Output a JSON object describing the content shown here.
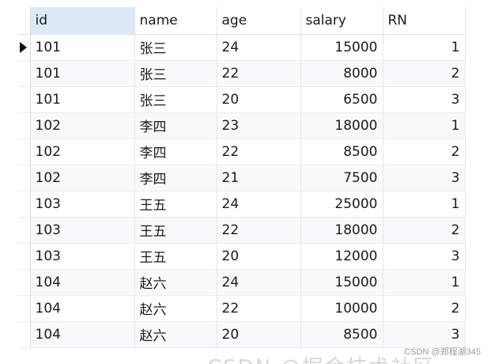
{
  "columns": [
    "id",
    "name",
    "age",
    "salary",
    "RN"
  ],
  "rows": [
    {
      "id": "101",
      "name": "张三",
      "age": "24",
      "salary": "15000",
      "rn": "1"
    },
    {
      "id": "101",
      "name": "张三",
      "age": "22",
      "salary": "8000",
      "rn": "2"
    },
    {
      "id": "101",
      "name": "张三",
      "age": "20",
      "salary": "6500",
      "rn": "3"
    },
    {
      "id": "102",
      "name": "李四",
      "age": "23",
      "salary": "18000",
      "rn": "1"
    },
    {
      "id": "102",
      "name": "李四",
      "age": "22",
      "salary": "8500",
      "rn": "2"
    },
    {
      "id": "102",
      "name": "李四",
      "age": "21",
      "salary": "7500",
      "rn": "3"
    },
    {
      "id": "103",
      "name": "王五",
      "age": "24",
      "salary": "25000",
      "rn": "1"
    },
    {
      "id": "103",
      "name": "王五",
      "age": "22",
      "salary": "18000",
      "rn": "2"
    },
    {
      "id": "103",
      "name": "王五",
      "age": "20",
      "salary": "12000",
      "rn": "3"
    },
    {
      "id": "104",
      "name": "赵六",
      "age": "24",
      "salary": "15000",
      "rn": "1"
    },
    {
      "id": "104",
      "name": "赵六",
      "age": "22",
      "salary": "10000",
      "rn": "2"
    },
    {
      "id": "104",
      "name": "赵六",
      "age": "20",
      "salary": "8500",
      "rn": "3"
    }
  ],
  "selected_row_index": 0,
  "watermark": "CSDN @郑程湖345",
  "ghost_text": "CSDN @掘金技术社区"
}
